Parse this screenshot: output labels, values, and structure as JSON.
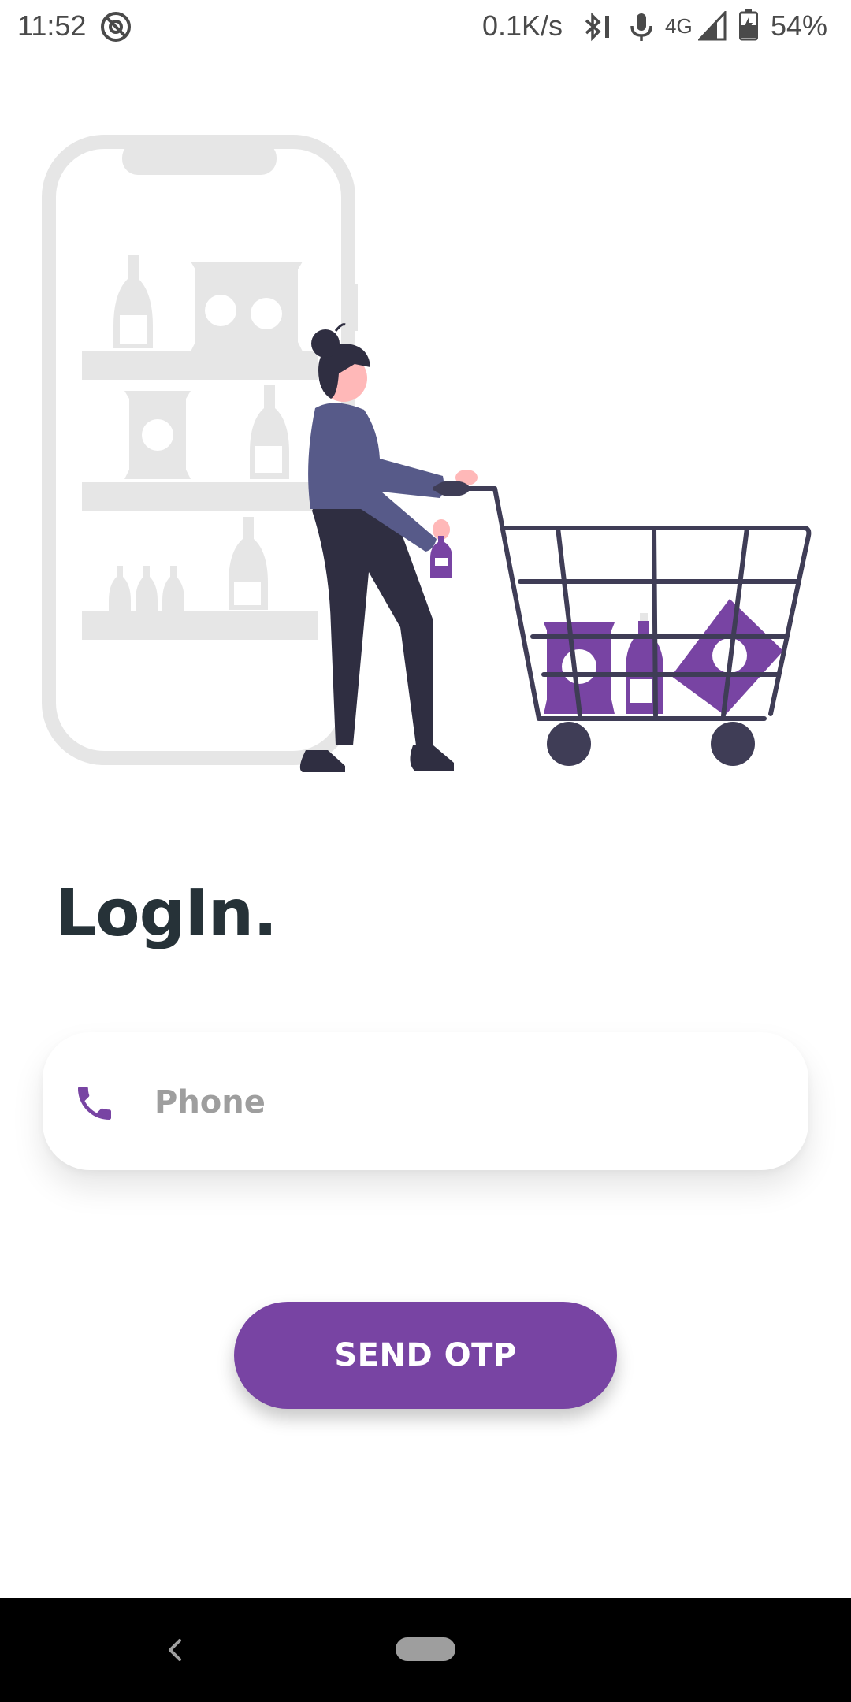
{
  "status_bar": {
    "time": "11:52",
    "net_speed": "0.1K/s",
    "network_type": "4G",
    "battery": "54%",
    "icons": [
      "app-notification-icon",
      "bluetooth-icon",
      "mic-icon",
      "signal-icon",
      "battery-charging-icon"
    ]
  },
  "illustration": {
    "name": "woman-with-shopping-cart",
    "colors": {
      "accent": "#7844a3",
      "shelf_gray": "#e6e6e6",
      "dark": "#2f2e41",
      "shirt": "#575a89",
      "skin": "#ffb8b8"
    }
  },
  "login": {
    "title": "LogIn."
  },
  "phone_field": {
    "placeholder": "Phone",
    "value": "",
    "icon": "phone-icon"
  },
  "send_button": {
    "label": "SEND OTP",
    "color": "#7844a3"
  },
  "nav_bar": {
    "icons": [
      "back-icon",
      "home-pill"
    ]
  }
}
